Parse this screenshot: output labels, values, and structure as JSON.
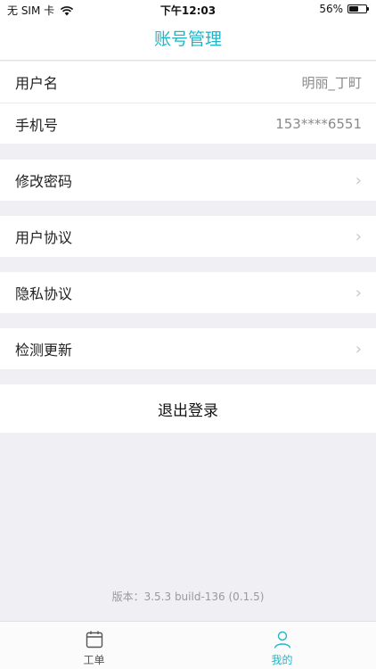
{
  "status_bar": {
    "carrier": "无 SIM 卡",
    "time": "下午12:03",
    "battery_percent": "56%",
    "battery_level": 0.56,
    "icons": [
      "wifi-icon",
      "battery-icon"
    ]
  },
  "nav": {
    "title": "账号管理"
  },
  "account": {
    "username_label": "用户名",
    "username_value": "明丽_丁町",
    "phone_label": "手机号",
    "phone_value": "153****6551"
  },
  "menu": {
    "change_password": "修改密码",
    "user_agreement": "用户协议",
    "privacy_policy": "隐私协议",
    "check_update": "检测更新",
    "chevron_icon": "chevron-right-icon"
  },
  "logout_label": "退出登录",
  "version_text": "版本：3.5.3 build-136 (0.1.5)",
  "tabbar": {
    "tabs": [
      {
        "label": "工单",
        "icon": "calendar-icon",
        "active": false
      },
      {
        "label": "我的",
        "icon": "person-icon",
        "active": true
      }
    ]
  },
  "colors": {
    "accent": "#1fb7c8",
    "background": "#efeff4",
    "muted": "#8a8a8a"
  }
}
